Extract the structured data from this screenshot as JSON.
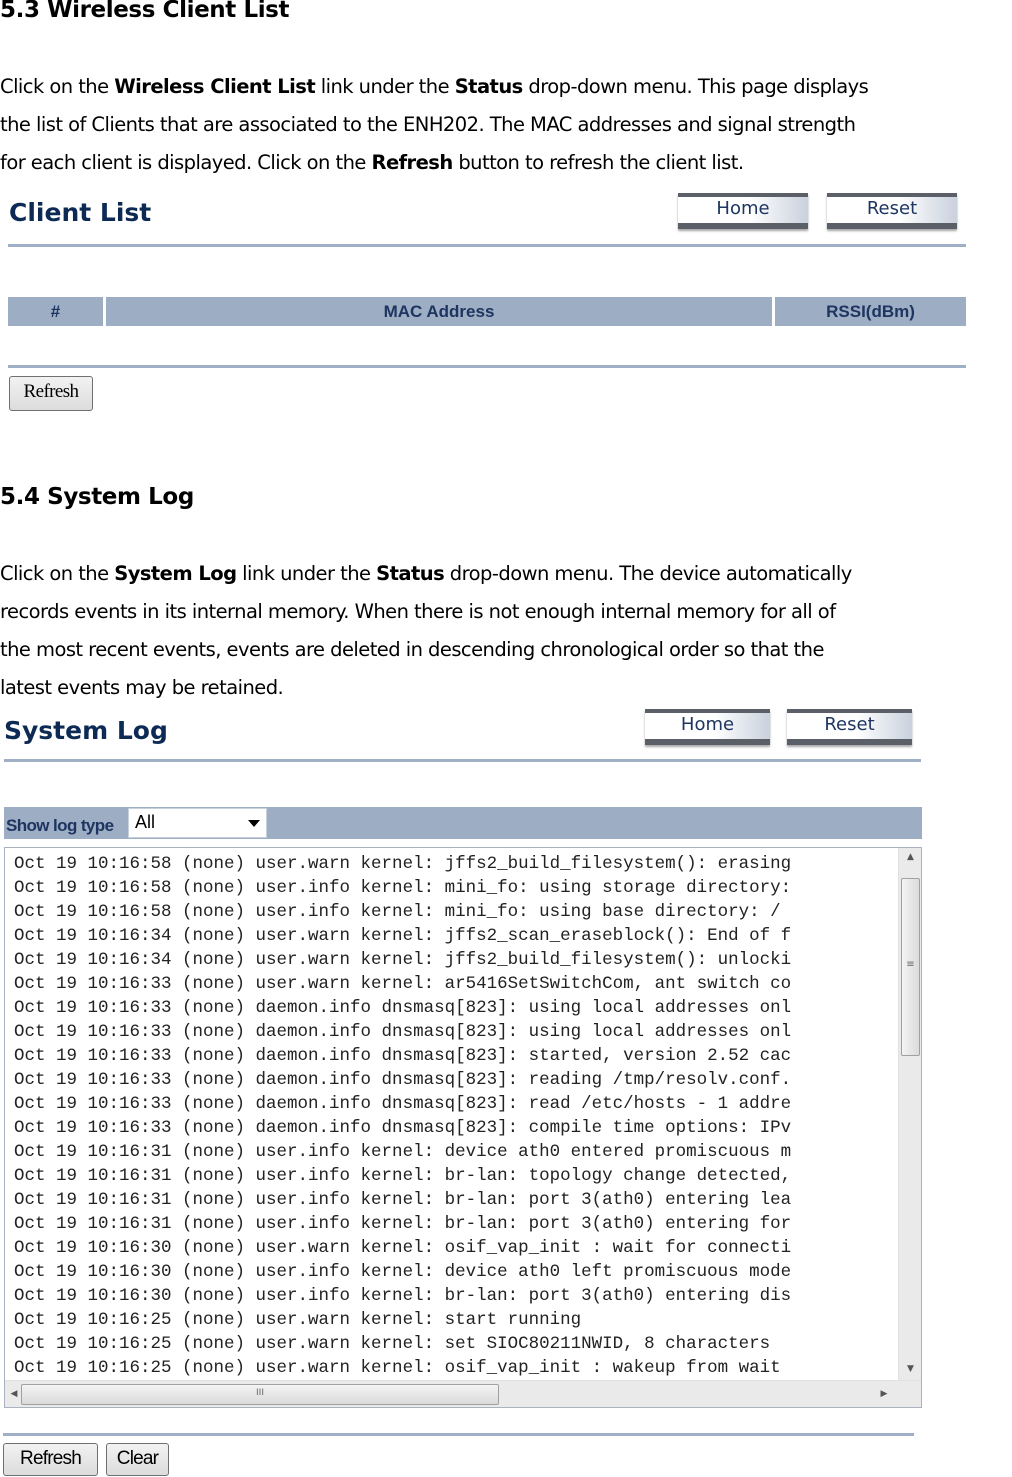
{
  "section_53": {
    "heading": "5.3 Wireless Client List",
    "paragraph_lines": [
      [
        {
          "t": "Click on the ",
          "b": false
        },
        {
          "t": "Wireless Client List",
          "b": true
        },
        {
          "t": " link under the ",
          "b": false
        },
        {
          "t": "Status",
          "b": true
        },
        {
          "t": " drop-down menu. This page displays",
          "b": false
        }
      ],
      [
        {
          "t": "the list of Clients that are associated to the ENH202. The MAC addresses and signal strength",
          "b": false
        }
      ],
      [
        {
          "t": "for each client is displayed. Click on the ",
          "b": false
        },
        {
          "t": "Refresh",
          "b": true
        },
        {
          "t": " button to refresh the client list.",
          "b": false
        }
      ]
    ]
  },
  "client_list_panel": {
    "title": "Client List",
    "home_label": "Home",
    "reset_label": "Reset",
    "columns": [
      "#",
      "MAC Address",
      "RSSI(dBm)"
    ],
    "rows": [],
    "refresh_label": "Refresh"
  },
  "section_54": {
    "heading": "5.4 System Log",
    "paragraph_lines": [
      [
        {
          "t": "Click on the ",
          "b": false
        },
        {
          "t": "System Log",
          "b": true
        },
        {
          "t": " link under the ",
          "b": false
        },
        {
          "t": "Status",
          "b": true
        },
        {
          "t": " drop-down menu. The device automatically",
          "b": false
        }
      ],
      [
        {
          "t": "records events in its internal memory. When there is not enough internal memory for all of",
          "b": false
        }
      ],
      [
        {
          "t": "the most recent events, events are deleted in descending chronological order so that the",
          "b": false
        }
      ],
      [
        {
          "t": "latest events may be retained.",
          "b": false
        }
      ]
    ]
  },
  "system_log_panel": {
    "title": "System Log",
    "home_label": "Home",
    "reset_label": "Reset",
    "filter_label": "Show log type",
    "filter_value": "All",
    "log_lines": [
      "Oct 19 10:16:58 (none) user.warn kernel: jffs2_build_filesystem(): erasing",
      "Oct 19 10:16:58 (none) user.info kernel: mini_fo: using storage directory:",
      "Oct 19 10:16:58 (none) user.info kernel: mini_fo: using base directory: /",
      "Oct 19 10:16:34 (none) user.warn kernel: jffs2_scan_eraseblock(): End of f",
      "Oct 19 10:16:34 (none) user.warn kernel: jffs2_build_filesystem(): unlocki",
      "Oct 19 10:16:33 (none) user.warn kernel: ar5416SetSwitchCom, ant switch co",
      "Oct 19 10:16:33 (none) daemon.info dnsmasq[823]: using local addresses onl",
      "Oct 19 10:16:33 (none) daemon.info dnsmasq[823]: using local addresses onl",
      "Oct 19 10:16:33 (none) daemon.info dnsmasq[823]: started, version 2.52 cac",
      "Oct 19 10:16:33 (none) daemon.info dnsmasq[823]: reading /tmp/resolv.conf.",
      "Oct 19 10:16:33 (none) daemon.info dnsmasq[823]: read /etc/hosts - 1 addre",
      "Oct 19 10:16:33 (none) daemon.info dnsmasq[823]: compile time options: IPv",
      "Oct 19 10:16:31 (none) user.info kernel: device ath0 entered promiscuous m",
      "Oct 19 10:16:31 (none) user.info kernel: br-lan: topology change detected,",
      "Oct 19 10:16:31 (none) user.info kernel: br-lan: port 3(ath0) entering lea",
      "Oct 19 10:16:31 (none) user.info kernel: br-lan: port 3(ath0) entering for",
      "Oct 19 10:16:30 (none) user.warn kernel: osif_vap_init : wait for connecti",
      "Oct 19 10:16:30 (none) user.info kernel: device ath0 left promiscuous mode",
      "Oct 19 10:16:30 (none) user.info kernel: br-lan: port 3(ath0) entering dis",
      "Oct 19 10:16:25 (none) user.warn kernel: start running",
      "Oct 19 10:16:25 (none) user.warn kernel: set SIOC80211NWID, 8 characters",
      "Oct 19 10:16:25 (none) user.warn kernel: osif_vap_init : wakeup from wait"
    ],
    "scroll": {
      "vertical_arrow_up": "▲",
      "vertical_arrow_down": "▼",
      "horizontal_arrow_left": "◀",
      "horizontal_arrow_right": "▶",
      "vertical_grip": "≡",
      "horizontal_grip": "III"
    },
    "refresh_label": "Refresh",
    "clear_label": "Clear"
  }
}
